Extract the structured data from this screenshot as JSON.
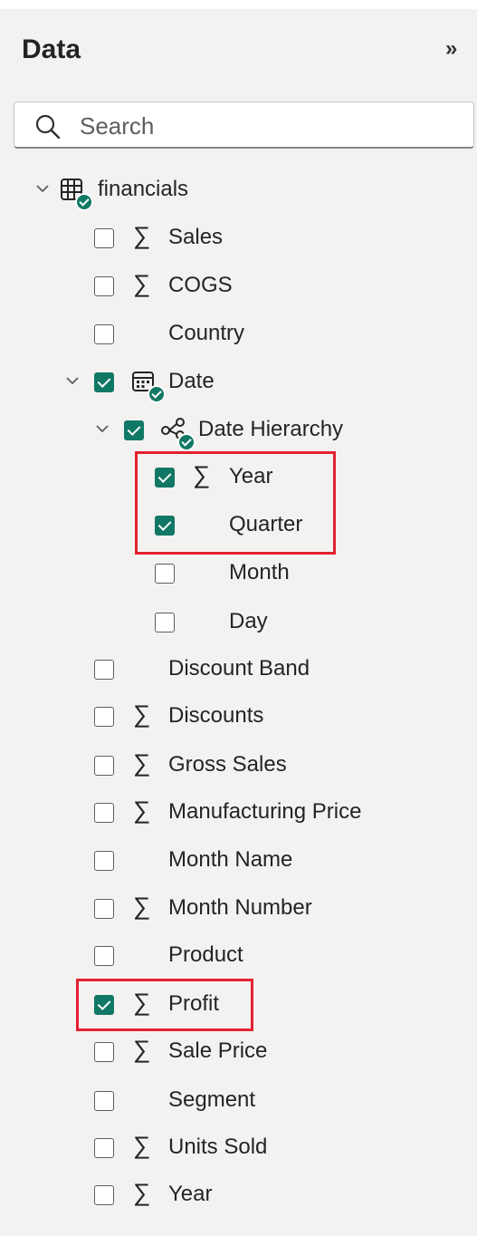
{
  "pane": {
    "title": "Data",
    "collapse_glyph": "»",
    "search_placeholder": "Search"
  },
  "colors": {
    "accent": "#117865",
    "highlight": "#e3212f"
  },
  "tree": {
    "table": {
      "label": "financials",
      "icon": "table-icon",
      "expanded": true
    },
    "fields": [
      {
        "label": "Sales",
        "checked": false,
        "sigma": true
      },
      {
        "label": "COGS",
        "checked": false,
        "sigma": true
      },
      {
        "label": "Country",
        "checked": false,
        "sigma": false
      },
      {
        "label": "Date",
        "checked": true,
        "icon": "calendar-icon",
        "expanded": true
      },
      {
        "label": "Date Hierarchy",
        "checked": true,
        "icon": "hierarchy-icon",
        "expanded": true
      },
      {
        "label": "Year",
        "checked": true,
        "sigma": true
      },
      {
        "label": "Quarter",
        "checked": true,
        "sigma": false
      },
      {
        "label": "Month",
        "checked": false,
        "sigma": false
      },
      {
        "label": "Day",
        "checked": false,
        "sigma": false
      },
      {
        "label": "Discount Band",
        "checked": false,
        "sigma": false
      },
      {
        "label": "Discounts",
        "checked": false,
        "sigma": true
      },
      {
        "label": "Gross Sales",
        "checked": false,
        "sigma": true
      },
      {
        "label": "Manufacturing Price",
        "checked": false,
        "sigma": true
      },
      {
        "label": "Month Name",
        "checked": false,
        "sigma": false
      },
      {
        "label": "Month Number",
        "checked": false,
        "sigma": true
      },
      {
        "label": "Product",
        "checked": false,
        "sigma": false
      },
      {
        "label": "Profit",
        "checked": true,
        "sigma": true
      },
      {
        "label": "Sale Price",
        "checked": false,
        "sigma": true
      },
      {
        "label": "Segment",
        "checked": false,
        "sigma": false
      },
      {
        "label": "Units Sold",
        "checked": false,
        "sigma": true
      },
      {
        "label": "Year",
        "checked": false,
        "sigma": true
      }
    ]
  }
}
